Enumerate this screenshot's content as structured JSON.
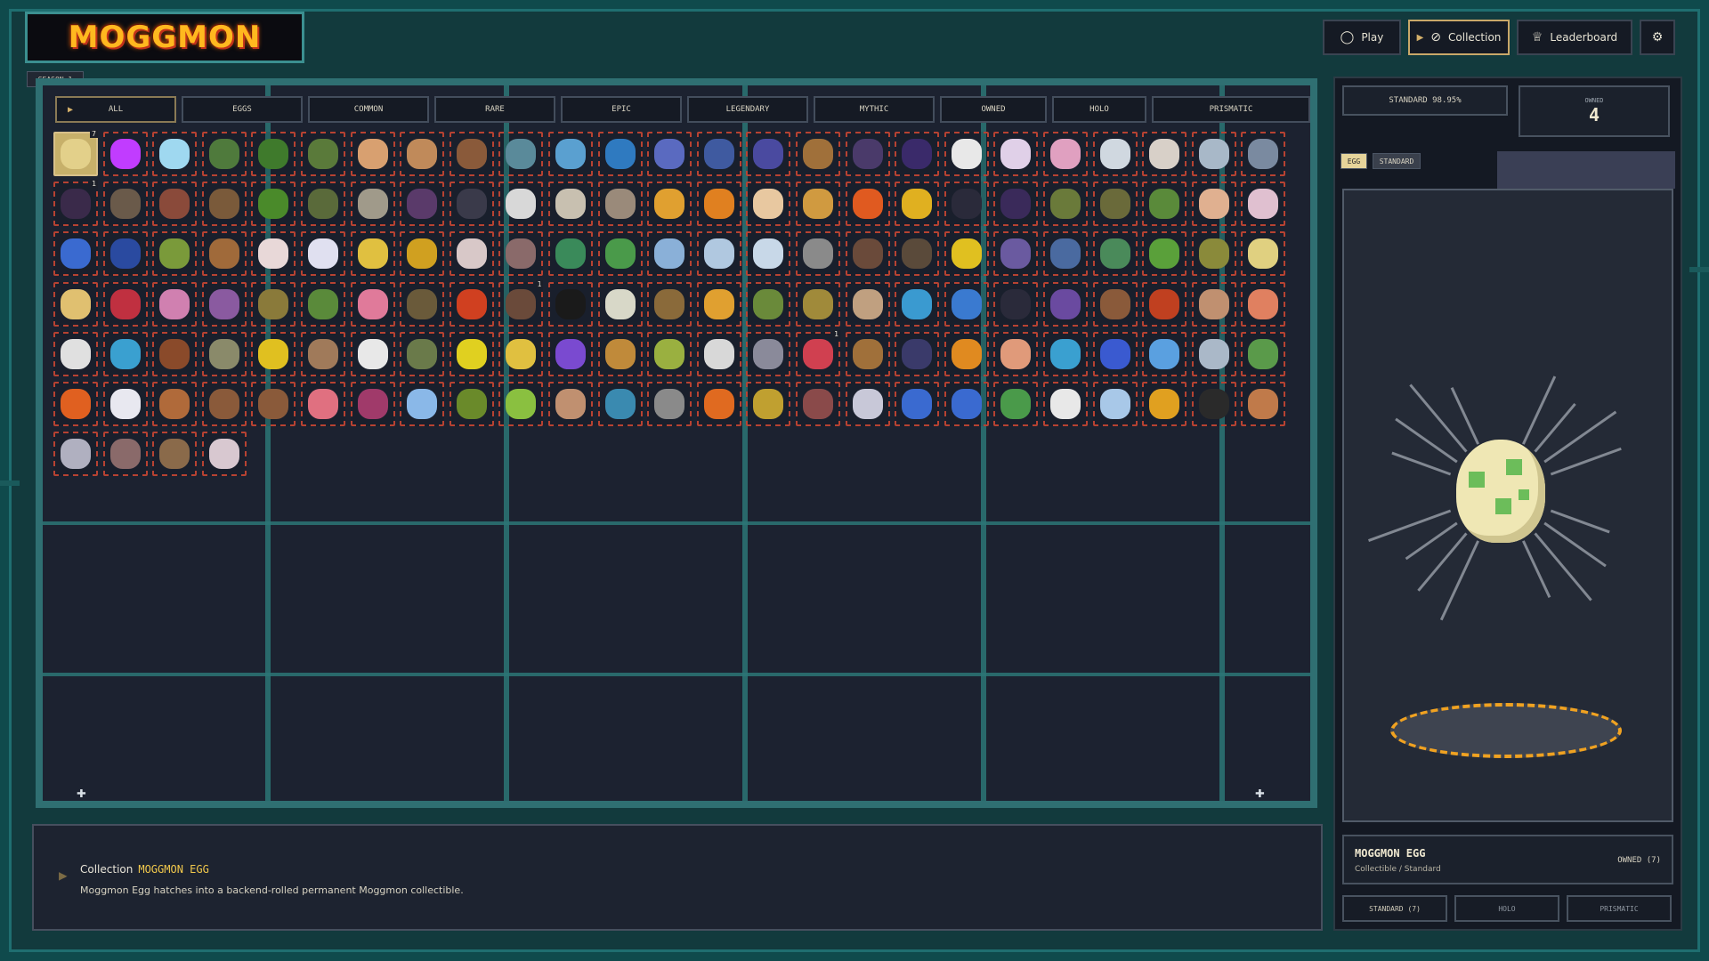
{
  "app": {
    "logo": "MOGGMON",
    "season": "SEASON 1"
  },
  "nav": [
    {
      "label": "Play",
      "icon": "circle-icon",
      "glyph": "◯",
      "active": false
    },
    {
      "label": "Collection",
      "icon": "check-circle-icon",
      "glyph": "⊘",
      "active": true
    },
    {
      "label": "Leaderboard",
      "icon": "trophy-icon",
      "glyph": "♕",
      "active": false
    }
  ],
  "nav_extra": {
    "icon": "steam-icon",
    "glyph": "⚙"
  },
  "filters": [
    "ALL",
    "EGGS",
    "COMMON",
    "RARE",
    "EPIC",
    "LEGENDARY",
    "MYTHIC",
    "OWNED",
    "HOLO",
    "PRISMATIC"
  ],
  "grid": {
    "columns": 25,
    "total_cards": 154,
    "selected_index": 0
  },
  "badges": [
    {
      "index": 0,
      "text": "7"
    },
    {
      "index": 25,
      "text": "1"
    },
    {
      "index": 84,
      "text": "1"
    },
    {
      "index": 115,
      "text": "1"
    }
  ],
  "sprite_colors": [
    "#e3d08a",
    "#c13cff",
    "#9fd8f0",
    "#4f7a3c",
    "#3f7a2c",
    "#5a7a3a",
    "#d8a070",
    "#c08a5a",
    "#8a5a3a",
    "#5a8a9a",
    "#5aa0d0",
    "#2f7ac0",
    "#5a6ac0",
    "#3f5aa0",
    "#4a4aa0",
    "#a0703a",
    "#4a3a6a",
    "#3a2a6a",
    "#e8e8e8",
    "#e0d0e8",
    "#e0a0c0",
    "#d0d8e0",
    "#d8d0c8",
    "#a8b8c8",
    "#7a8aa0",
    "#3a2a4a",
    "#6a5a4a",
    "#8a4a3a",
    "#7a5a3a",
    "#4a8a2a",
    "#5a6a3a",
    "#a09a8a",
    "#5a3a6a",
    "#3a3a4a",
    "#d8d8d8",
    "#c8c0b0",
    "#9a8a7a",
    "#e0a030",
    "#e08020",
    "#e8c8a0",
    "#d09a40",
    "#e05a20",
    "#e0b020",
    "#2a2a3a",
    "#3a2a5a",
    "#6a7a3a",
    "#6a6a3a",
    "#5a8a3a",
    "#e0b090",
    "#e0c0d0",
    "#3a6ad0",
    "#2a4aa0",
    "#7a9a3a",
    "#a06a3a",
    "#e8d8d8",
    "#e0e0f0",
    "#e0c040",
    "#d0a020",
    "#d8c8c8",
    "#8a6a6a",
    "#3a8a5a",
    "#4a9a4a",
    "#8ab0d8",
    "#b0c8e0",
    "#c8d8e8",
    "#8a8a8a",
    "#6a4a3a",
    "#5a4a3a",
    "#e0c020",
    "#6a5aa0",
    "#4a6aa0",
    "#4a8a5a",
    "#5aa03a",
    "#8a8a3a",
    "#e0d080",
    "#e0c070",
    "#c03040",
    "#d080b0",
    "#8a5aa0",
    "#8a7a3a",
    "#5a8a3a",
    "#e07a9a",
    "#6a5a3a",
    "#d04020",
    "#6a4a3a",
    "#1a1a1a",
    "#d8d8c8",
    "#8a6a3a",
    "#e0a030",
    "#6a8a3a",
    "#a08a3a",
    "#c0a080",
    "#3a9ad0",
    "#3a7ad0",
    "#2a2a3a",
    "#6a4aa0",
    "#8a5a3a",
    "#c04020",
    "#c09070",
    "#e08060",
    "#e0e0e0",
    "#3aa0d0",
    "#8a4a2a",
    "#8a8a6a",
    "#e0c020",
    "#a07a5a",
    "#e8e8e8",
    "#6a7a4a",
    "#e0d020",
    "#e0c040",
    "#7a4ad0",
    "#c08a3a",
    "#9ab040",
    "#d8d8d8",
    "#8a8a9a",
    "#d04050",
    "#a0703a",
    "#3a3a6a",
    "#e08a20",
    "#e09a7a",
    "#3aa0d0",
    "#3a5ad0",
    "#5aa0e0",
    "#aab8c8",
    "#5a9a4a",
    "#e06020",
    "#e8e8f0",
    "#b06a3a",
    "#8a5a3a",
    "#8a5a3a",
    "#e07080",
    "#a03a6a",
    "#8ab8e8",
    "#6a8a2a",
    "#8ac040",
    "#c09070",
    "#3a8ab0",
    "#8a8a8a",
    "#e06a20",
    "#c0a030",
    "#8a4a4a",
    "#c8c8d8",
    "#3a6ad0",
    "#3a6ad0",
    "#4a9a4a",
    "#e8e8e8",
    "#a8c8e8",
    "#e0a020",
    "#2a2a2a",
    "#c07a4a",
    "#b0b0c0",
    "#8a6a6a",
    "#8a6a4a",
    "#d8c8d0"
  ],
  "info": {
    "prefix": "Collection",
    "title": "MOGGMON EGG",
    "description": "Moggmon Egg hatches into a backend-rolled permanent Moggmon collectible."
  },
  "side": {
    "stat_label": "STANDARD 98.95%",
    "owned_label": "OWNED",
    "owned_value": "4",
    "tags": [
      "EGG",
      "STANDARD"
    ],
    "name": "MOGGMON EGG",
    "subtitle": "Collectible / Standard",
    "owned_count": "OWNED (7)",
    "variant_buttons": [
      "STANDARD (7)",
      "HOLO",
      "PRISMATIC"
    ]
  },
  "colors": {
    "accent": "#f2c94c",
    "frame": "#2f6f72",
    "card_border": "#b74232",
    "platform_ring": "#f0a221",
    "egg": "#efe7b4",
    "egg_spots": "#6cbd5a"
  }
}
